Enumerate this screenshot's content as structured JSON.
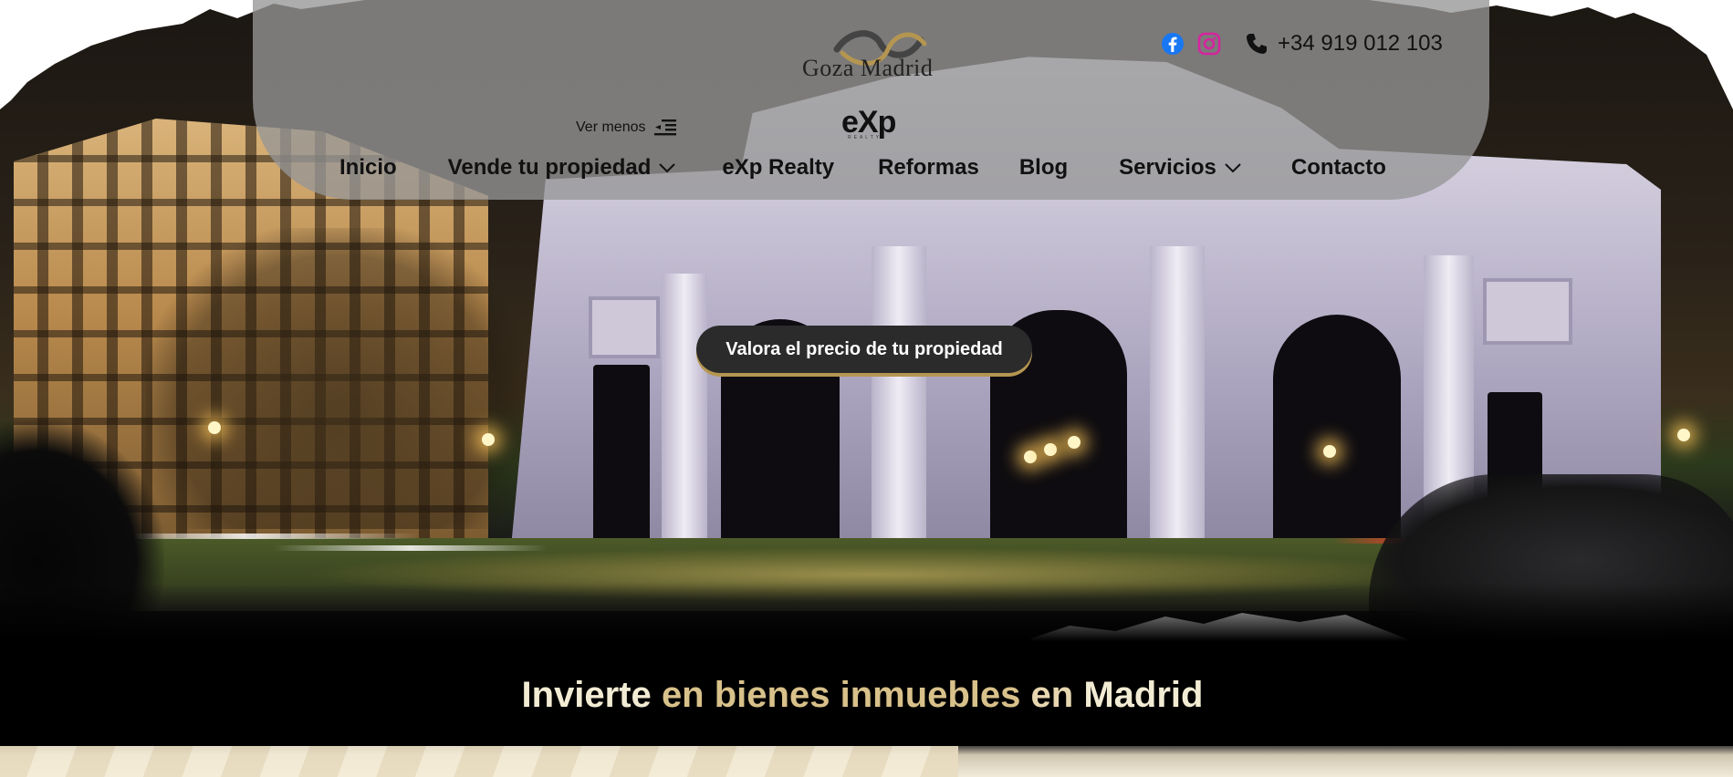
{
  "header": {
    "brand_name": "Goza Madrid",
    "partner_logo": "eXp",
    "partner_logo_sub": "REALTY",
    "toggle_menu_label": "Ver menos",
    "phone": "+34 919 012 103",
    "social_icons": [
      "facebook-icon",
      "instagram-icon"
    ],
    "nav": [
      {
        "label": "Inicio",
        "has_dropdown": false
      },
      {
        "label": "Vende tu propiedad",
        "has_dropdown": true
      },
      {
        "label": "eXp Realty",
        "has_dropdown": false
      },
      {
        "label": "Reformas",
        "has_dropdown": false
      },
      {
        "label": "Blog",
        "has_dropdown": false
      },
      {
        "label": "Servicios",
        "has_dropdown": true
      },
      {
        "label": "Contacto",
        "has_dropdown": false
      }
    ]
  },
  "hero": {
    "cta_label": "Valora el precio de tu propiedad"
  },
  "headline": {
    "part1": "Invierte",
    "part2": "en",
    "part3": "bienes inmuebles",
    "part4": "en",
    "part5": "Madrid"
  },
  "colors": {
    "accent_gold": "#d8c18a",
    "gold_light": "#e7d7b0",
    "cream": "#f3ecd4",
    "facebook": "#1877f2",
    "instagram": "#d6249f",
    "header_bg": "rgba(150,150,150,0.78)"
  }
}
